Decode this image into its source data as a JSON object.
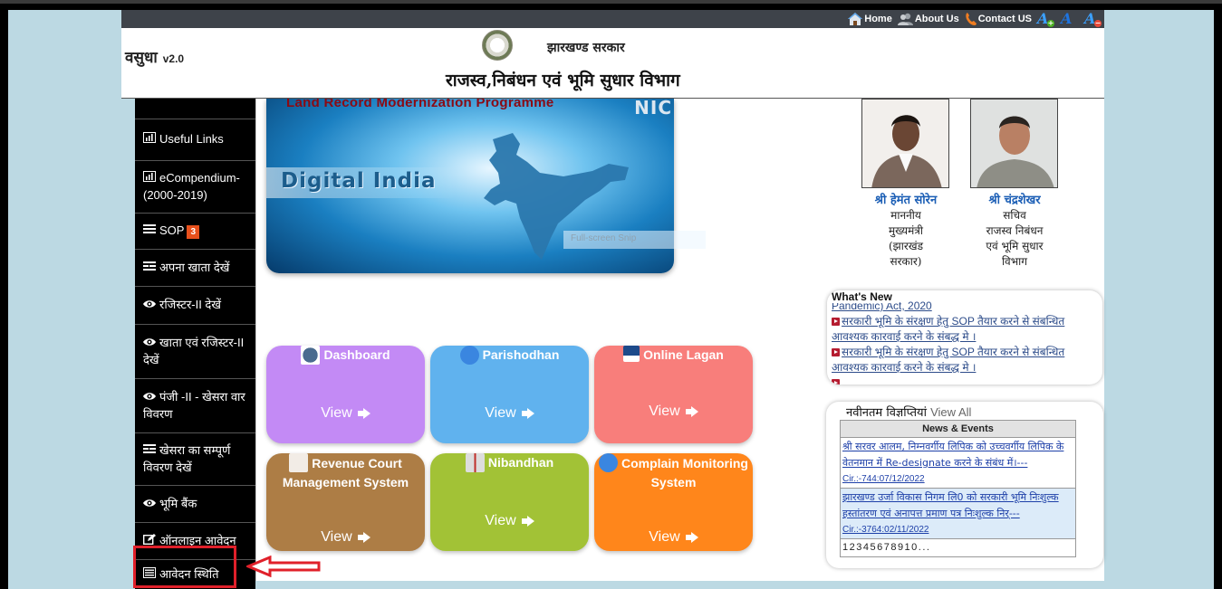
{
  "topnav": {
    "home": "Home",
    "about": "About Us",
    "contact": "Contact US",
    "font_increase_icon": "font-increase",
    "font_normal_icon": "font-normal",
    "font_decrease_icon": "font-decrease"
  },
  "header": {
    "brand": "वसुधा",
    "version": "v2.0",
    "government": "झारखण्ड सरकार",
    "department": "राजस्व,निबंधन एवं भूमि सुधार  विभाग"
  },
  "sidebar": {
    "items": [
      {
        "icon": "bar-chart",
        "label": "Useful Links"
      },
      {
        "icon": "bar-chart",
        "label": "eCompendium-(2000-2019)"
      },
      {
        "icon": "list",
        "label": "SOP",
        "badge": "3"
      },
      {
        "icon": "list-alt",
        "label": "अपना खाता देखें"
      },
      {
        "icon": "eye",
        "label": "रजिस्टर-II देखें"
      },
      {
        "icon": "eye",
        "label": "खाता एवं रजिस्टर-II देखें"
      },
      {
        "icon": "eye",
        "label": "पंजी -II - खेसरा वार विवरण"
      },
      {
        "icon": "list-alt",
        "label": "खेसरा का सम्पूर्ण विवरण देखें"
      },
      {
        "icon": "eye",
        "label": "भूमि बैंक"
      },
      {
        "icon": "edit",
        "label": "ऑनलाइन आवेदन"
      },
      {
        "icon": "list",
        "label": "आवेदन स्थिति"
      }
    ],
    "highlighted_index": 10
  },
  "banner": {
    "title": "Land Record Modernization Programme",
    "logo": "NIC",
    "caption": "Digital India",
    "overlay": "Full-screen Snip"
  },
  "tiles": [
    {
      "title": "Dashboard",
      "action": "View",
      "color": "#c38af5"
    },
    {
      "title": "Parishodhan",
      "action": "View",
      "color": "#60b2ee"
    },
    {
      "title": "Online Lagan",
      "action": "View",
      "color": "#f87e7b"
    },
    {
      "title": "Revenue Court Management System",
      "action": "View",
      "color": "#ad7d45"
    },
    {
      "title": "Nibandhan",
      "action": "View",
      "color": "#a2c236"
    },
    {
      "title": "Complain Monitoring System",
      "action": "View",
      "color": "#ff861b"
    }
  ],
  "officials": [
    {
      "name": "श्री हेमंत सोरेन",
      "desc": [
        "माननीय",
        "मुख्यमंत्री",
        "(झारखंड",
        "सरकार)"
      ]
    },
    {
      "name": "श्री चंद्रशेखर",
      "desc": [
        "सचिव",
        "राजस्व निबंधन",
        "एवं भूमि सुधार",
        "विभाग"
      ]
    }
  ],
  "whats_new": {
    "title": "What's New",
    "items": [
      "Pandemic) Act, 2020",
      "सरकारी भूमि के संरक्षण हेतु SOP तैयार करने से संबन्धित आवश्यक कारवाई करने के संबद्ध मे ।",
      "सरकारी भूमि के संरक्षण हेतु SOP तैयार करने से संबन्धित आवश्यक कारवाई करने के संबद्ध मे ।"
    ]
  },
  "notices": {
    "heading": "नवीनतम विज्ञप्तियां",
    "view_all": "View All",
    "table_header": "News & Events",
    "rows": [
      {
        "text": "श्री सरवर आलम, निम्नवर्गीय लिपिक को उच्चवर्गीय लिपिक के वेतनमान में Re-designate करने के संबंध में।---",
        "cir": "Cir.:-744:07/12/2022"
      },
      {
        "text": "झारखण्ड उर्जा विकास निगम लि0 को सरकारी भूमि निःशुल्क हस्तांतरण एवं अनापत्त प्रमाण पत्र निःशुल्क निर्---",
        "cir": "Cir.:-3764:02/11/2022"
      }
    ],
    "pager": "12345678910..."
  },
  "colors": {
    "topbar": "#3e434a",
    "sidebar": "#000000",
    "page_bg": "#bcd9e3",
    "highlight": "#e0202a",
    "badge": "#e8501c"
  }
}
